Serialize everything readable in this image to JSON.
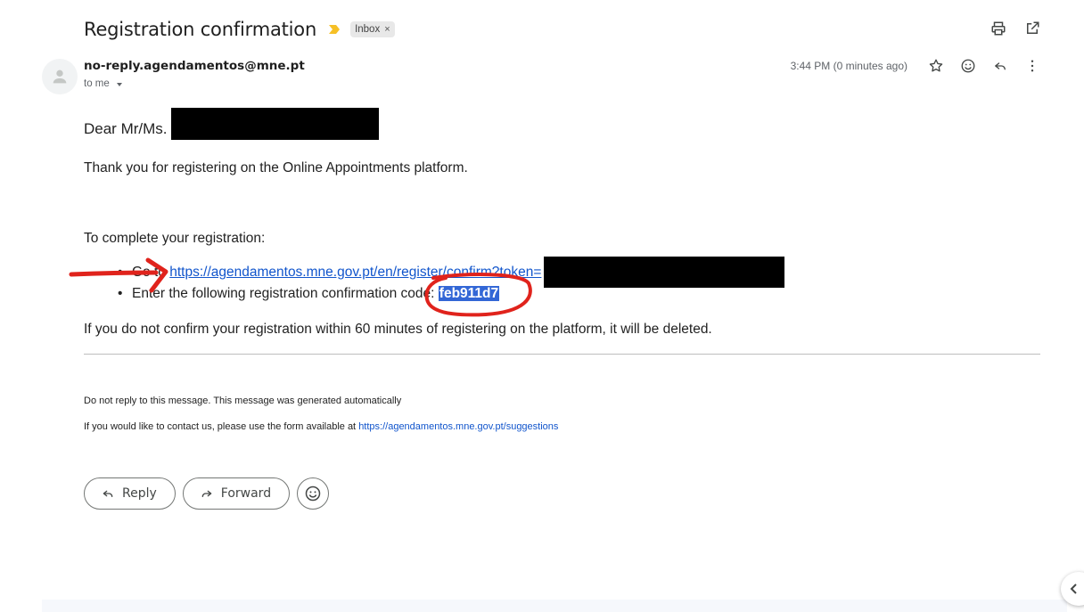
{
  "email": {
    "subject": "Registration confirmation",
    "label": "Inbox",
    "label_remove": "×",
    "sender": "no-reply.agendamentos@mne.pt",
    "recipient": "to me",
    "timestamp": "3:44 PM (0 minutes ago)"
  },
  "body": {
    "greeting": "Dear Mr/Ms.",
    "thanks": "Thank you for registering on the Online Appointments platform.",
    "complete_intro": "To complete your registration:",
    "bullet1_prefix": "Go to",
    "bullet1_link": "https://agendamentos.mne.gov.pt/en/register/confirm?token=",
    "bullet2_prefix": "Enter the following registration confirmation code:",
    "code": "feb911d7",
    "deleted_notice": "If you do not confirm your registration within 60 minutes of registering on the platform, it will be deleted.",
    "no_reply": "Do not reply to this message. This message was generated automatically",
    "contact_prefix": "If you would like to contact us, please use the form available at",
    "contact_link": "https://agendamentos.mne.gov.pt/suggestions"
  },
  "actions": {
    "reply": "Reply",
    "forward": "Forward"
  },
  "icons": {
    "importance": "importance-marker-icon",
    "print": "print-icon",
    "open_new": "open-in-new-window-icon",
    "star": "star-icon",
    "emoji": "emoji-reaction-icon",
    "reply": "reply-icon",
    "more": "more-vert-icon",
    "forward": "forward-icon",
    "avatar": "avatar-person-icon",
    "collapse": "chevron-left-icon"
  },
  "colors": {
    "link": "#1155cc",
    "highlight": "#3367d6",
    "annotation": "#e0231c",
    "importance": "#f6c026",
    "redaction": "#000000"
  }
}
